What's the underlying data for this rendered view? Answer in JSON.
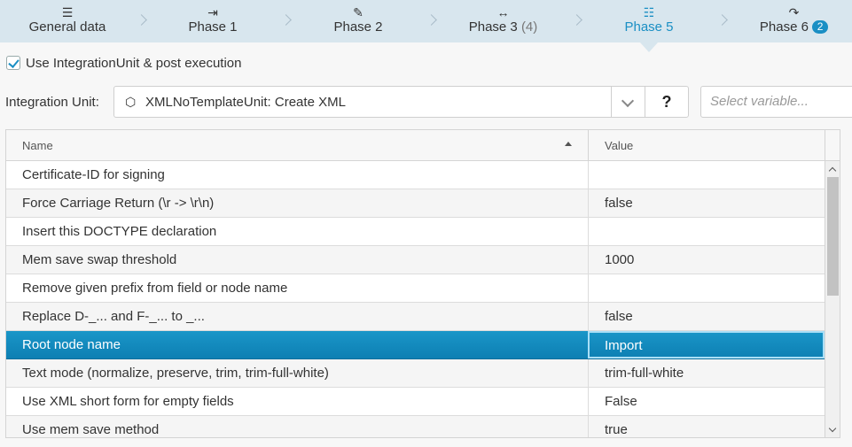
{
  "phases": [
    {
      "icon": "list-icon",
      "glyph": "☰",
      "label": "General data",
      "count": "",
      "badge": ""
    },
    {
      "icon": "step-in-icon",
      "glyph": "⇥",
      "label": "Phase 1",
      "count": "",
      "badge": ""
    },
    {
      "icon": "file-edit-icon",
      "glyph": "✎",
      "label": "Phase 2",
      "count": "",
      "badge": ""
    },
    {
      "icon": "arrows-horizontal-icon",
      "glyph": "↔",
      "label": "Phase 3",
      "count": "(4)",
      "badge": ""
    },
    {
      "icon": "server-icon",
      "glyph": "☷",
      "label": "Phase 5",
      "count": "",
      "badge": ""
    },
    {
      "icon": "share-arrow-icon",
      "glyph": "↷",
      "label": "Phase 6",
      "count": "",
      "badge": "2"
    }
  ],
  "active_phase": "Phase 5",
  "use_integration_unit": {
    "checked": true,
    "label": "Use IntegrationUnit & post execution"
  },
  "integration_unit": {
    "label": "Integration Unit:",
    "value": "XMLNoTemplateUnit: Create XML",
    "help": "?",
    "variable_placeholder": "Select variable..."
  },
  "grid": {
    "columns": {
      "name": "Name",
      "value": "Value"
    },
    "sort": "name-ascending",
    "rows": [
      {
        "name": "Certificate-ID for signing",
        "value": ""
      },
      {
        "name": "Force Carriage Return (\\r -> \\r\\n)",
        "value": "false"
      },
      {
        "name": "Insert this DOCTYPE declaration",
        "value": ""
      },
      {
        "name": "Mem save swap threshold",
        "value": "1000"
      },
      {
        "name": "Remove given prefix from field or node name",
        "value": ""
      },
      {
        "name": "Replace D-_... and F-_... to _...",
        "value": "false"
      },
      {
        "name": "Root node name",
        "value": "Import",
        "selected": true
      },
      {
        "name": "Text mode (normalize, preserve, trim, trim-full-white)",
        "value": "trim-full-white"
      },
      {
        "name": "Use XML short form for empty fields",
        "value": "False"
      },
      {
        "name": "Use mem save method",
        "value": "true"
      }
    ]
  },
  "colors": {
    "accent": "#1a8fc4",
    "selected_row": "#1189bd",
    "nav_bg": "#d8e6ee"
  }
}
